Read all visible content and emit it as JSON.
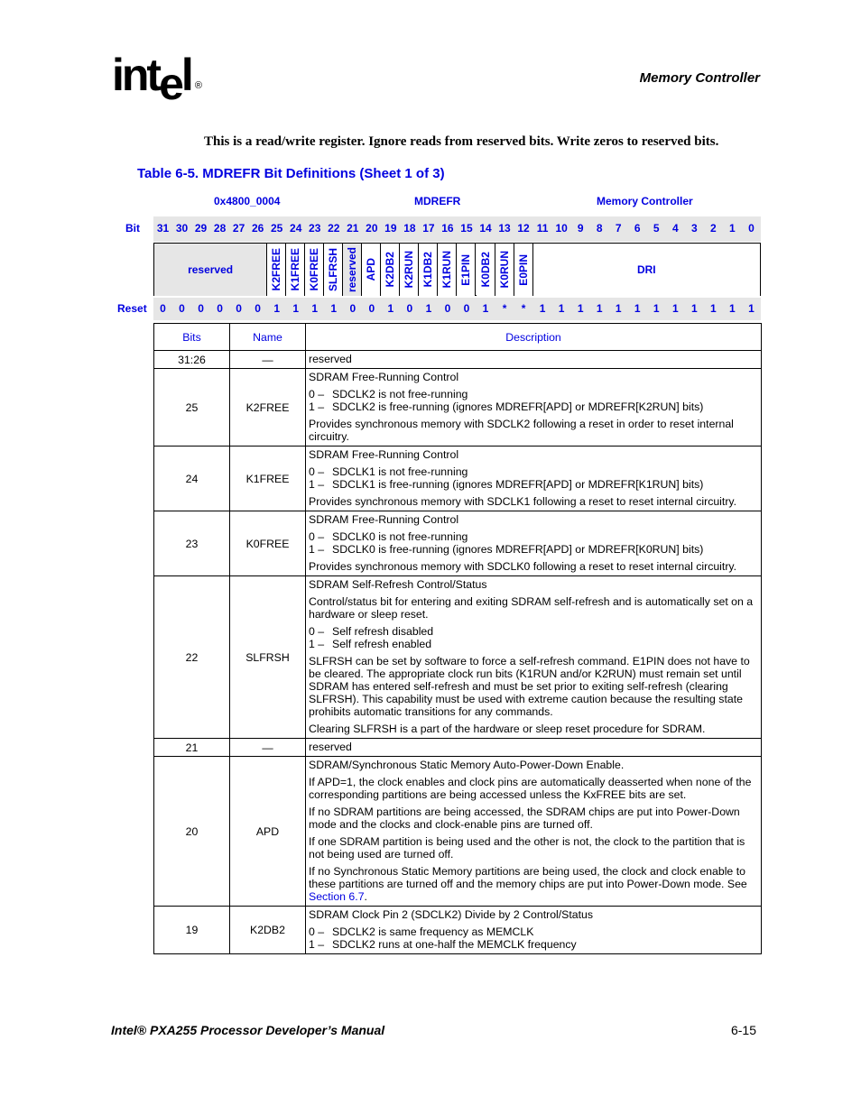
{
  "header": {
    "logo": {
      "part1": "int",
      "part2": "e",
      "part3": "l",
      "registered": "®"
    },
    "section_title": "Memory Controller"
  },
  "intro_text": "This is a read/write register. Ignore reads from reserved bits. Write zeros to reserved bits.",
  "table_caption": "Table 6-5. MDREFR Bit Definitions (Sheet 1 of 3)",
  "register": {
    "address": "0x4800_0004",
    "name": "MDREFR",
    "unit": "Memory Controller",
    "bit_label": "Bit",
    "reset_label": "Reset",
    "bits": [
      "31",
      "30",
      "29",
      "28",
      "27",
      "26",
      "25",
      "24",
      "23",
      "22",
      "21",
      "20",
      "19",
      "18",
      "17",
      "16",
      "15",
      "14",
      "13",
      "12",
      "11",
      "10",
      "9",
      "8",
      "7",
      "6",
      "5",
      "4",
      "3",
      "2",
      "1",
      "0"
    ],
    "reset_values": [
      "0",
      "0",
      "0",
      "0",
      "0",
      "0",
      "1",
      "1",
      "1",
      "1",
      "0",
      "0",
      "1",
      "0",
      "1",
      "0",
      "0",
      "1",
      "*",
      "*",
      "1",
      "1",
      "1",
      "1",
      "1",
      "1",
      "1",
      "1",
      "1",
      "1",
      "1",
      "1"
    ],
    "fields": [
      {
        "label": "reserved",
        "msb": 31,
        "lsb": 26,
        "vertical": false,
        "reserved": true
      },
      {
        "label": "K2FREE",
        "msb": 25,
        "lsb": 25,
        "vertical": true,
        "reserved": false
      },
      {
        "label": "K1FREE",
        "msb": 24,
        "lsb": 24,
        "vertical": true,
        "reserved": false
      },
      {
        "label": "K0FREE",
        "msb": 23,
        "lsb": 23,
        "vertical": true,
        "reserved": false
      },
      {
        "label": "SLFRSH",
        "msb": 22,
        "lsb": 22,
        "vertical": true,
        "reserved": false
      },
      {
        "label": "reserved",
        "msb": 21,
        "lsb": 21,
        "vertical": true,
        "reserved": true
      },
      {
        "label": "APD",
        "msb": 20,
        "lsb": 20,
        "vertical": true,
        "reserved": false
      },
      {
        "label": "K2DB2",
        "msb": 19,
        "lsb": 19,
        "vertical": true,
        "reserved": false
      },
      {
        "label": "K2RUN",
        "msb": 18,
        "lsb": 18,
        "vertical": true,
        "reserved": false
      },
      {
        "label": "K1DB2",
        "msb": 17,
        "lsb": 17,
        "vertical": true,
        "reserved": false
      },
      {
        "label": "K1RUN",
        "msb": 16,
        "lsb": 16,
        "vertical": true,
        "reserved": false
      },
      {
        "label": "E1PIN",
        "msb": 15,
        "lsb": 15,
        "vertical": true,
        "reserved": false
      },
      {
        "label": "K0DB2",
        "msb": 14,
        "lsb": 14,
        "vertical": true,
        "reserved": false
      },
      {
        "label": "K0RUN",
        "msb": 13,
        "lsb": 13,
        "vertical": true,
        "reserved": false
      },
      {
        "label": "E0PIN",
        "msb": 12,
        "lsb": 12,
        "vertical": true,
        "reserved": false
      },
      {
        "label": "DRI",
        "msb": 11,
        "lsb": 0,
        "vertical": false,
        "reserved": false
      }
    ]
  },
  "desc_table": {
    "headers": {
      "bits": "Bits",
      "name": "Name",
      "description": "Description"
    },
    "rows": [
      {
        "bits": "31:26",
        "name": "—",
        "paras": [
          [
            "reserved"
          ]
        ]
      },
      {
        "bits": "25",
        "name": "K2FREE",
        "paras": [
          [
            "SDRAM Free-Running Control"
          ],
          [
            "0 –|SDCLK2 is not free-running",
            "1 –|SDCLK2 is free-running (ignores MDREFR[APD] or MDREFR[K2RUN] bits)"
          ],
          [
            "Provides synchronous memory with SDCLK2 following a reset in order to reset internal circuitry."
          ]
        ]
      },
      {
        "bits": "24",
        "name": "K1FREE",
        "paras": [
          [
            "SDRAM Free-Running Control"
          ],
          [
            "0 –|SDCLK1 is not free-running",
            "1 –|SDCLK1 is free-running (ignores MDREFR[APD] or MDREFR[K1RUN] bits)"
          ],
          [
            "Provides synchronous memory with SDCLK1 following a reset to reset internal circuitry."
          ]
        ]
      },
      {
        "bits": "23",
        "name": "K0FREE",
        "paras": [
          [
            "SDRAM Free-Running Control"
          ],
          [
            "0 –|SDCLK0 is not free-running",
            "1 –|SDCLK0 is free-running (ignores MDREFR[APD] or MDREFR[K0RUN] bits)"
          ],
          [
            "Provides synchronous memory with SDCLK0 following a reset to reset internal circuitry."
          ]
        ]
      },
      {
        "bits": "22",
        "name": "SLFRSH",
        "paras": [
          [
            "SDRAM Self-Refresh Control/Status"
          ],
          [
            "Control/status bit for entering and exiting SDRAM self-refresh and is automatically set on a hardware or sleep reset."
          ],
          [
            "0 –|Self refresh disabled",
            "1 –|Self refresh enabled"
          ],
          [
            "SLFRSH can be set by software to force a self-refresh command. E1PIN does not have to be cleared. The appropriate clock run bits (K1RUN and/or K2RUN) must remain set until SDRAM has entered self-refresh and must be set prior to exiting self-refresh (clearing SLFRSH). This capability must be used with extreme caution because the resulting state prohibits automatic transitions for any commands."
          ],
          [
            "Clearing SLFRSH is a part of the hardware or sleep reset procedure for SDRAM."
          ]
        ]
      },
      {
        "bits": "21",
        "name": "—",
        "paras": [
          [
            "reserved"
          ]
        ]
      },
      {
        "bits": "20",
        "name": "APD",
        "paras": [
          [
            "SDRAM/Synchronous Static Memory Auto-Power-Down Enable."
          ],
          [
            "If APD=1, the clock enables and clock pins are automatically deasserted when none of the corresponding partitions are being accessed unless the KxFREE bits are set."
          ],
          [
            "If no SDRAM partitions are being accessed, the SDRAM chips are put into Power-Down mode and the clocks and clock-enable pins are turned off."
          ],
          [
            "If one SDRAM partition is being used and the other is not, the clock to the partition that is not being used are turned off."
          ],
          [
            "If no Synchronous Static Memory partitions are being used, the clock and clock enable to these partitions are turned off and the memory chips are put into Power-Down mode. See "
          ]
        ],
        "link": "Section 6.7",
        "link_suffix": "."
      },
      {
        "bits": "19",
        "name": "K2DB2",
        "paras": [
          [
            "SDRAM Clock Pin 2 (SDCLK2) Divide by 2 Control/Status"
          ],
          [
            "0 –|SDCLK2 is same frequency as MEMCLK",
            "1 –|SDCLK2 runs at one-half the MEMCLK frequency"
          ]
        ]
      }
    ]
  },
  "footer": {
    "manual_title": "Intel® PXA255 Processor Developer’s Manual",
    "page_number": "6-15"
  },
  "colors": {
    "accent_blue": "#0000e0",
    "band_grey": "#e6e6e6"
  }
}
